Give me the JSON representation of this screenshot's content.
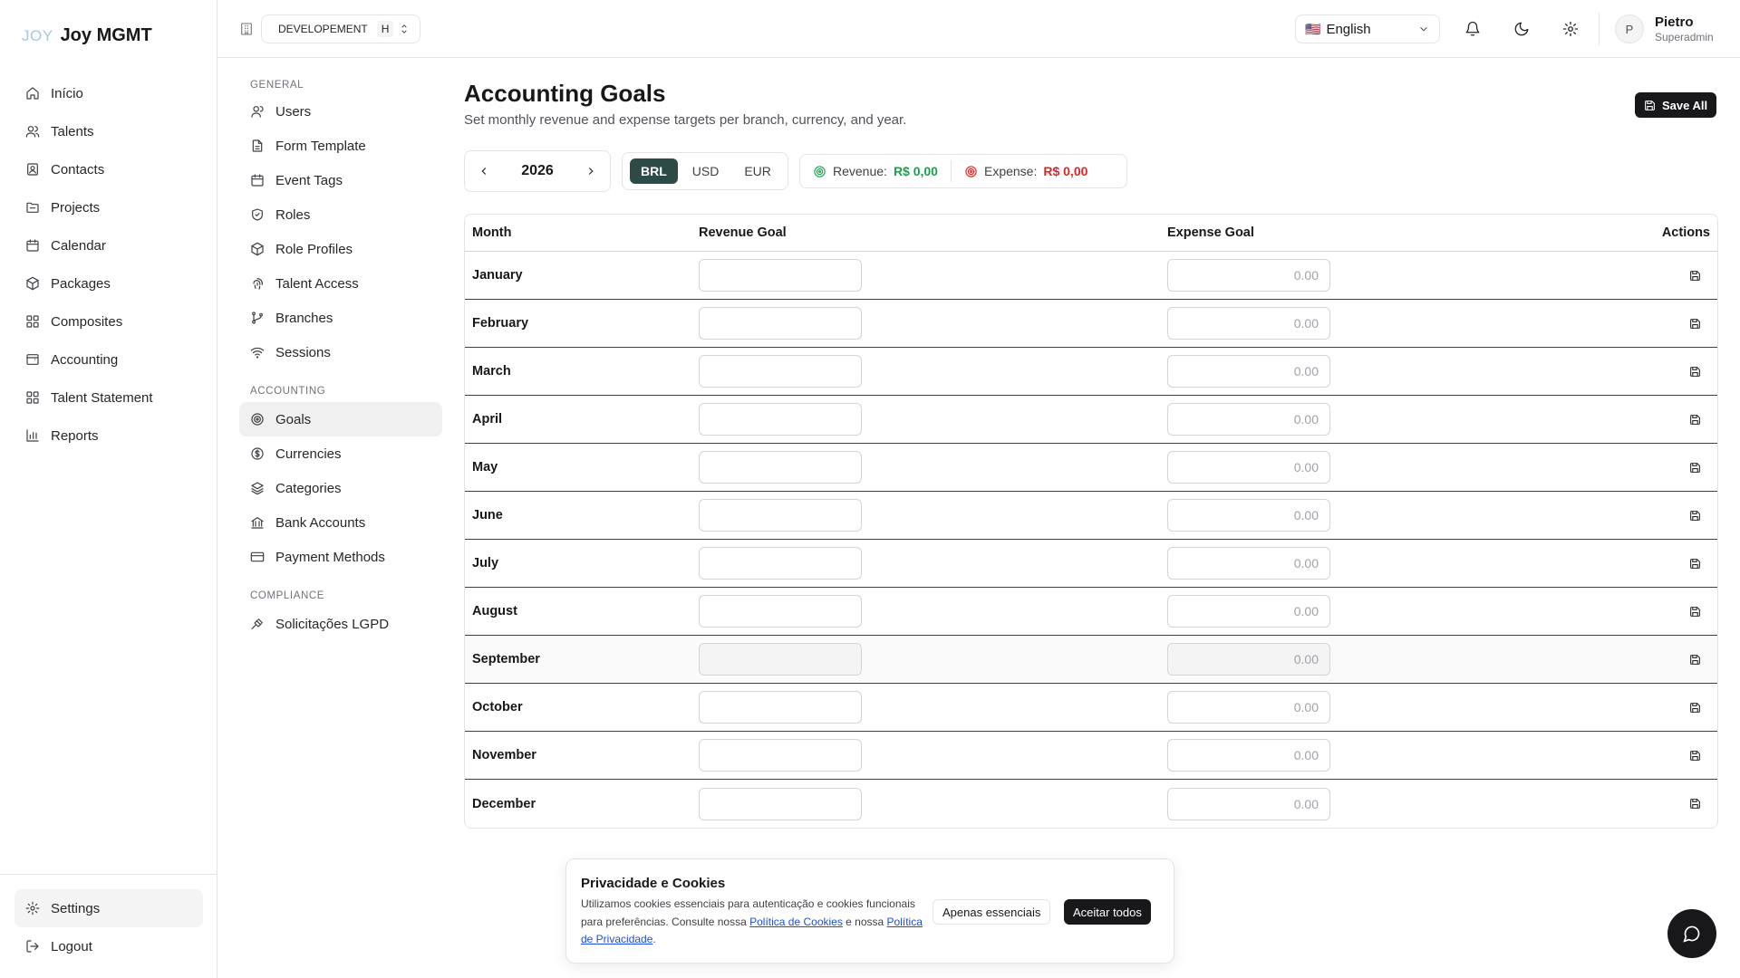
{
  "app": {
    "logo_mark": "JOY",
    "logo_text": "Joy MGMT"
  },
  "sidebar": {
    "items": [
      {
        "label": "Início",
        "icon": "home-icon"
      },
      {
        "label": "Talents",
        "icon": "users-icon"
      },
      {
        "label": "Contacts",
        "icon": "contact-icon"
      },
      {
        "label": "Projects",
        "icon": "folder-icon"
      },
      {
        "label": "Calendar",
        "icon": "calendar-icon"
      },
      {
        "label": "Packages",
        "icon": "package-icon"
      },
      {
        "label": "Composites",
        "icon": "grid-icon"
      },
      {
        "label": "Accounting",
        "icon": "wallet-icon"
      },
      {
        "label": "Talent Statement",
        "icon": "grid-icon"
      },
      {
        "label": "Reports",
        "icon": "chart-icon"
      }
    ],
    "settings_label": "Settings",
    "logout_label": "Logout"
  },
  "topbar": {
    "environment": "DEVELOPEMENT",
    "environment_badge": "H",
    "language_flag": "🇺🇸",
    "language": "English",
    "user_initial": "P",
    "user_name": "Pietro",
    "user_role": "Superadmin"
  },
  "subnav": {
    "general_title": "GENERAL",
    "general": [
      "Users",
      "Form Template",
      "Event Tags",
      "Roles",
      "Role Profiles",
      "Talent Access",
      "Branches",
      "Sessions"
    ],
    "accounting_title": "ACCOUNTING",
    "accounting": [
      "Goals",
      "Currencies",
      "Categories",
      "Bank Accounts",
      "Payment Methods"
    ],
    "compliance_title": "COMPLIANCE",
    "compliance": [
      "Solicitações LGPD"
    ]
  },
  "page": {
    "title": "Accounting Goals",
    "subtitle": "Set monthly revenue and expense targets per branch, currency, and year.",
    "save_all": "Save All",
    "year": "2026",
    "currencies": [
      "BRL",
      "USD",
      "EUR"
    ],
    "active_currency": "BRL",
    "revenue_label": "Revenue:",
    "revenue_value": "R$ 0,00",
    "expense_label": "Expense:",
    "expense_value": "R$ 0,00",
    "colors": {
      "revenue": "#16a34a",
      "expense": "#dc2626",
      "active_currency": "#2d4a47"
    }
  },
  "table": {
    "headers": {
      "month": "Month",
      "revenue": "Revenue Goal",
      "expense": "Expense Goal",
      "actions": "Actions"
    },
    "rows": [
      {
        "month": "January",
        "revenue": "",
        "expense_placeholder": "0.00"
      },
      {
        "month": "February",
        "revenue": "",
        "expense_placeholder": "0.00"
      },
      {
        "month": "March",
        "revenue": "",
        "expense_placeholder": "0.00"
      },
      {
        "month": "April",
        "revenue": "",
        "expense_placeholder": "0.00"
      },
      {
        "month": "May",
        "revenue": "",
        "expense_placeholder": "0.00"
      },
      {
        "month": "June",
        "revenue": "",
        "expense_placeholder": "0.00"
      },
      {
        "month": "July",
        "revenue": "",
        "expense_placeholder": "0.00"
      },
      {
        "month": "August",
        "revenue": "",
        "expense_placeholder": "0.00"
      },
      {
        "month": "September",
        "revenue": "",
        "expense_placeholder": "0.00"
      },
      {
        "month": "October",
        "revenue": "",
        "expense_placeholder": "0.00"
      },
      {
        "month": "November",
        "revenue": "",
        "expense_placeholder": "0.00"
      },
      {
        "month": "December",
        "revenue": "",
        "expense_placeholder": "0.00"
      }
    ]
  },
  "cookie": {
    "title": "Privacidade e Cookies",
    "text_1": "Utilizamos cookies essenciais para autenticação e cookies funcionais para preferências. Consulte nossa ",
    "link_cookies": "Política de Cookies",
    "text_2": " e nossa ",
    "link_privacy": "Política de Privacidade",
    "text_3": ".",
    "btn_essential": "Apenas essenciais",
    "btn_accept": "Aceitar todos"
  }
}
